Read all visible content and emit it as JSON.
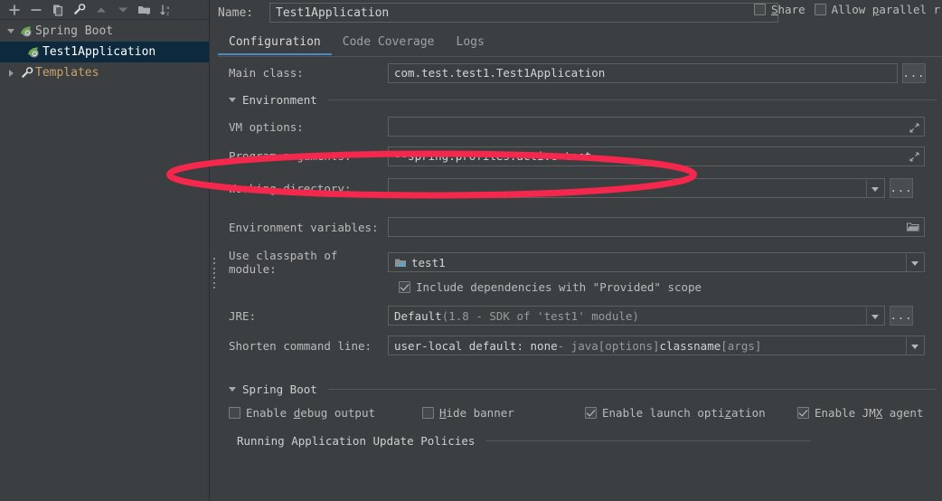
{
  "sidebar": {
    "toolbar": [
      {
        "name": "add-configuration-button",
        "icon": "plus-icon"
      },
      {
        "name": "remove-configuration-button",
        "icon": "minus-icon"
      },
      {
        "name": "copy-configuration-button",
        "icon": "copy-icon"
      },
      {
        "name": "edit-templates-button",
        "icon": "wrench-icon"
      },
      {
        "name": "move-up-button",
        "icon": "arrow-up-icon"
      },
      {
        "name": "move-down-button",
        "icon": "arrow-down-icon"
      },
      {
        "name": "new-folder-button",
        "icon": "folder-add-icon"
      },
      {
        "name": "sort-configurations-button",
        "icon": "sort-az-icon"
      }
    ],
    "tree": [
      {
        "label": "Spring Boot",
        "icon": "spring-boot-icon",
        "expanded": true,
        "selected": false,
        "level": 0
      },
      {
        "label": "Test1Application",
        "icon": "spring-boot-icon",
        "expanded": false,
        "selected": true,
        "level": 1
      },
      {
        "label": "Templates",
        "icon": "wrench-icon",
        "expanded": false,
        "selected": false,
        "level": 0
      }
    ]
  },
  "header": {
    "name_label": "Name:",
    "name_value": "Test1Application",
    "share_label": "Share",
    "share_checked": false,
    "allow_parallel_label": "Allow parallel r",
    "allow_parallel_checked": false
  },
  "tabs": [
    {
      "label": "Configuration",
      "active": true
    },
    {
      "label": "Code Coverage",
      "active": false
    },
    {
      "label": "Logs",
      "active": false
    }
  ],
  "form": {
    "main_class_label": "Main class:",
    "main_class_value": "com.test.test1.Test1Application",
    "browse_label": "...",
    "environment_section": "Environment",
    "vm_options_label": "VM options:",
    "vm_options_value": "",
    "program_arguments_label": "Program arguments:",
    "program_arguments_value": "--spring.profiles.active=test",
    "working_directory_label": "Working directory:",
    "working_directory_value": "",
    "environment_variables_label": "Environment variables:",
    "environment_variables_value": "",
    "use_classpath_label": "Use classpath of module:",
    "use_classpath_value": "test1",
    "include_dependencies_label": "Include dependencies with \"Provided\" scope",
    "include_dependencies_checked": true,
    "jre_label": "JRE:",
    "jre_value_bold": "Default",
    "jre_value_rest": " (1.8 - SDK of 'test1' module)",
    "shorten_command_label": "Shorten command line:",
    "shorten_command_value_a": "user-local default: none",
    "shorten_command_value_b": " - java ",
    "shorten_command_value_c": "[options]",
    "shorten_command_value_d": " classname ",
    "shorten_command_value_e": "[args]",
    "spring_boot_section": "Spring Boot",
    "enable_debug_label": "Enable debug output",
    "enable_debug_checked": false,
    "hide_banner_label": "Hide banner",
    "hide_banner_checked": false,
    "enable_launch_opt_label": "Enable launch optimization",
    "enable_launch_opt_checked": true,
    "enable_jmx_label": "Enable JMX agent",
    "enable_jmx_checked": true,
    "running_app_section": "Running Application Update Policies"
  },
  "annotation": {
    "type": "ellipse-highlight",
    "color": "#f5274c",
    "target": "Program arguments"
  }
}
